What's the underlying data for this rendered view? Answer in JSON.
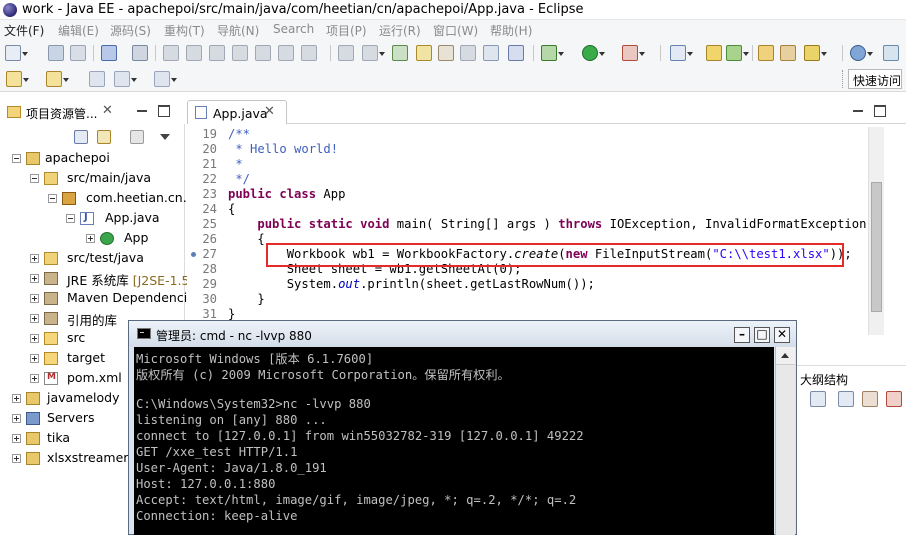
{
  "window": {
    "title": "work - Java EE - apachepoi/src/main/java/com/heetian/cn/apachepoi/App.java - Eclipse"
  },
  "menubar": {
    "items": [
      {
        "label": "文件(F)",
        "enabled": true
      },
      {
        "label": "编辑(E)",
        "enabled": false
      },
      {
        "label": "源码(S)",
        "enabled": false
      },
      {
        "label": "重构(T)",
        "enabled": false
      },
      {
        "label": "导航(N)",
        "enabled": false
      },
      {
        "label": "Search",
        "enabled": false
      },
      {
        "label": "项目(P)",
        "enabled": false
      },
      {
        "label": "运行(R)",
        "enabled": false
      },
      {
        "label": "窗口(W)",
        "enabled": false
      },
      {
        "label": "帮助(H)",
        "enabled": false
      }
    ]
  },
  "toolbar": {
    "quick_access": "快速访问"
  },
  "explorer": {
    "title": "项目资源管...",
    "tree": [
      {
        "label": "apachepoi",
        "icon": "project-icon",
        "expanded": true
      },
      {
        "label": "src/main/java",
        "icon": "source-folder-icon",
        "expanded": true
      },
      {
        "label": "com.heetian.cn.a",
        "icon": "package-icon",
        "expanded": true
      },
      {
        "label": "App.java",
        "icon": "java-file-icon",
        "expanded": true
      },
      {
        "label": "App",
        "icon": "class-icon",
        "expanded": false
      },
      {
        "label": "src/test/java",
        "icon": "source-folder-icon",
        "expanded": false
      },
      {
        "label": "JRE 系统库",
        "extra": "[J2SE-1.5",
        "icon": "library-icon",
        "expanded": false
      },
      {
        "label": "Maven Dependenci",
        "icon": "library-icon",
        "expanded": false
      },
      {
        "label": "引用的库",
        "icon": "library-icon",
        "expanded": false
      },
      {
        "label": "src",
        "icon": "folder-icon",
        "expanded": false
      },
      {
        "label": "target",
        "icon": "folder-icon",
        "expanded": false
      },
      {
        "label": "pom.xml",
        "icon": "xml-file-icon",
        "expanded": false
      },
      {
        "label": "javamelody",
        "icon": "project-icon",
        "expanded": false
      },
      {
        "label": "Servers",
        "icon": "project-icon",
        "expanded": false
      },
      {
        "label": "tika",
        "icon": "project-icon",
        "expanded": false
      },
      {
        "label": "xlsxstreamer",
        "icon": "project-icon",
        "expanded": false
      }
    ]
  },
  "editor": {
    "tab_label": "App.java",
    "lines": [
      {
        "n": "19",
        "t": "/**"
      },
      {
        "n": "20",
        "t": " * Hello world!"
      },
      {
        "n": "21",
        "t": " *"
      },
      {
        "n": "22",
        "t": " */"
      },
      {
        "n": "23",
        "t": "public class App"
      },
      {
        "n": "24",
        "t": "{"
      },
      {
        "n": "25",
        "t": "    public static void main( String[] args ) throws IOException, InvalidFormatException"
      },
      {
        "n": "26",
        "t": "    {"
      },
      {
        "n": "27",
        "t": "        Workbook wb1 = WorkbookFactory.create(new FileInputStream(\"C:\\\\test1.xlsx\"));"
      },
      {
        "n": "28",
        "t": "        Sheet sheet = wb1.getSheetAt(0);"
      },
      {
        "n": "29",
        "t": "        System.out.println(sheet.getLastRowNum());"
      },
      {
        "n": "30",
        "t": "    }"
      },
      {
        "n": "31",
        "t": "}"
      }
    ],
    "highlight_color": "#e52a2a"
  },
  "outline": {
    "label": "大纲结构"
  },
  "cmd": {
    "title": "管理员: cmd - nc  -lvvp 880",
    "lines": [
      "Microsoft Windows [版本 6.1.7600]",
      "版权所有 (c) 2009 Microsoft Corporation。保留所有权利。",
      "",
      "C:\\Windows\\System32>nc -lvvp 880",
      "listening on [any] 880 ...",
      "connect to [127.0.0.1] from win55032782-319 [127.0.0.1] 49222",
      "GET /xxe_test HTTP/1.1",
      "User-Agent: Java/1.8.0_191",
      "Host: 127.0.0.1:880",
      "Accept: text/html, image/gif, image/jpeg, *; q=.2, */*; q=.2",
      "Connection: keep-alive"
    ]
  }
}
